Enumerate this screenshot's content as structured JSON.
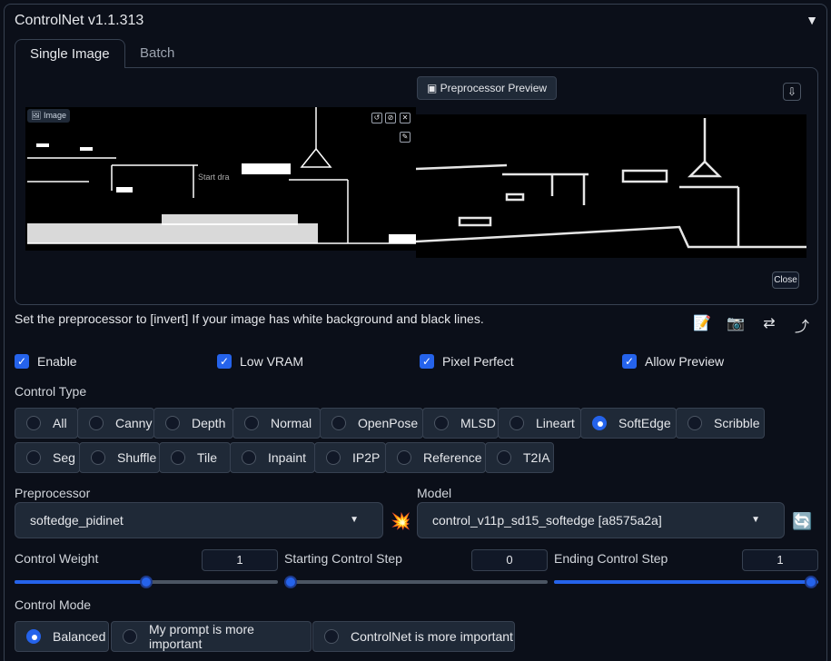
{
  "panel": {
    "title": "ControlNet v1.1.313",
    "collapse_icon": "▼"
  },
  "tabs": [
    {
      "label": "Single Image"
    },
    {
      "label": "Batch"
    }
  ],
  "image_area": {
    "image_chip": "Image",
    "start_drawing": "Start dra",
    "preview_chip": "Preprocessor Preview",
    "close_label": "Close"
  },
  "hint": "Set the preprocessor to [invert] If your image has white background and black lines.",
  "tool_icons": [
    "📝",
    "📷",
    "⇄",
    "⤴"
  ],
  "checkboxes": [
    {
      "label": "Enable",
      "checked": true
    },
    {
      "label": "Low VRAM",
      "checked": true
    },
    {
      "label": "Pixel Perfect",
      "checked": true
    },
    {
      "label": "Allow Preview",
      "checked": true
    }
  ],
  "control_type": {
    "label": "Control Type",
    "options_row1": [
      "All",
      "Canny",
      "Depth",
      "Normal",
      "OpenPose",
      "MLSD",
      "Lineart",
      "SoftEdge",
      "Scribble"
    ],
    "options_row2": [
      "Seg",
      "Shuffle",
      "Tile",
      "Inpaint",
      "IP2P",
      "Reference",
      "T2IA"
    ],
    "selected": "SoftEdge"
  },
  "preprocessor": {
    "label": "Preprocessor",
    "value": "softedge_pidinet"
  },
  "model": {
    "label": "Model",
    "value": "control_v11p_sd15_softedge [a8575a2a]"
  },
  "sliders": {
    "weight": {
      "label": "Control Weight",
      "value": "1",
      "fraction": 0.5
    },
    "start": {
      "label": "Starting Control Step",
      "value": "0",
      "fraction": 0.0
    },
    "end": {
      "label": "Ending Control Step",
      "value": "1",
      "fraction": 1.0
    }
  },
  "control_mode": {
    "label": "Control Mode",
    "options": [
      "Balanced",
      "My prompt is more important",
      "ControlNet is more important"
    ],
    "selected": "Balanced"
  },
  "colors": {
    "accent": "#2563eb",
    "bg": "#0b0f19",
    "surface": "#1f2937"
  }
}
